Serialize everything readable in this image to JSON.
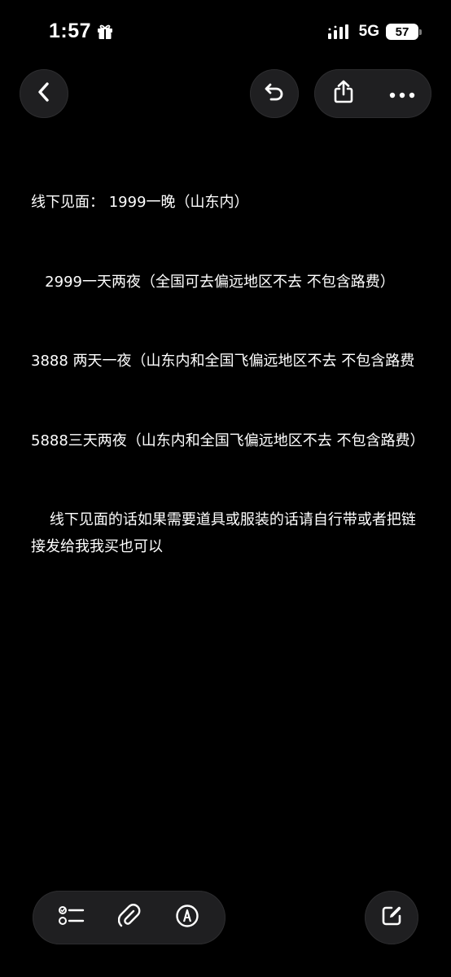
{
  "status_bar": {
    "time": "1:57",
    "network": "5G",
    "battery_level": "57",
    "icons": [
      "gift-icon",
      "signal-icon"
    ]
  },
  "toolbar": {
    "icons": [
      "chevron-left-icon",
      "undo-icon",
      "share-icon",
      "ellipsis-icon"
    ]
  },
  "note": {
    "lines": [
      "线下见面： 1999一晚（山东内）",
      "   2999一天两夜（全国可去偏远地区不去 不包含路费）",
      "3888 两天一夜（山东内和全国飞偏远地区不去 不包含路费",
      "5888三天两夜（山东内和全国飞偏远地区不去 不包含路费）",
      "    线下见面的话如果需要道具或服装的话请自行带或者把链接发给我我买也可以"
    ]
  },
  "bottom_toolbar": {
    "icons": [
      "checklist-icon",
      "paperclip-icon",
      "markup-pen-icon",
      "compose-icon"
    ]
  },
  "colors": {
    "background": "#000000",
    "text": "#ffffff",
    "button_bg": "#1f1f21"
  }
}
